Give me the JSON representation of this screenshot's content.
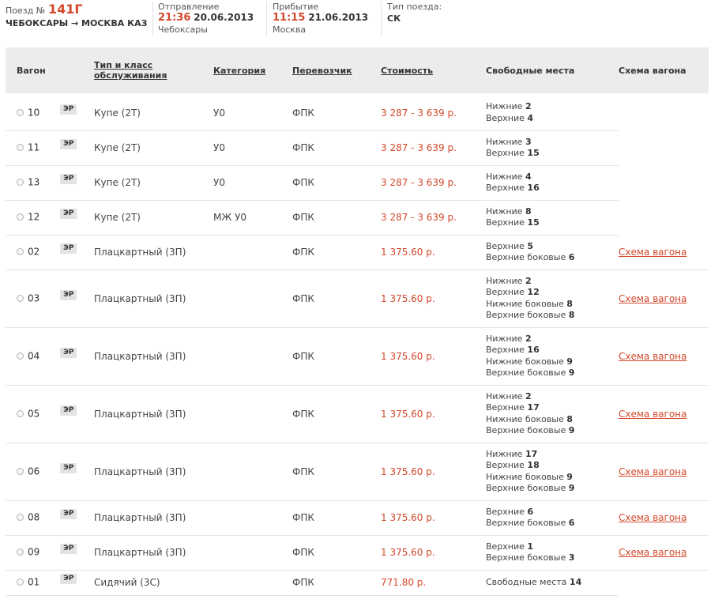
{
  "header": {
    "train_label": "Поезд №",
    "train_number": "141Г",
    "route": "ЧЕБОКСАРЫ → МОСКВА КАЗ",
    "departure_label": "Отправление",
    "departure_time": "21:36",
    "departure_date": "20.06.2013",
    "departure_city": "Чебоксары",
    "arrival_label": "Прибытие",
    "arrival_time": "11:15",
    "arrival_date": "21.06.2013",
    "arrival_city": "Москва",
    "train_type_label": "Тип поезда:",
    "train_type": "СК"
  },
  "columns": {
    "wagon": "Вагон",
    "class_line1": "Тип и класс",
    "class_line2": "обслуживания",
    "category": "Категория",
    "carrier": "Перевозчик",
    "cost": "Стоимость",
    "free_seats": "Свободные места",
    "schema": "Схема вагона"
  },
  "badge_label": "ЭР",
  "schema_link_label": "Схема вагона",
  "colors": {
    "accent": "#d3482b",
    "header_bg": "#ececec"
  },
  "rows": [
    {
      "car": "10",
      "cls": "Купе (2Т)",
      "cat": "У0",
      "carrier": "ФПК",
      "price": "3 287 - 3 639 р.",
      "schema": false,
      "seats": [
        {
          "label": "Нижние",
          "count": "2"
        },
        {
          "label": "Верхние",
          "count": "4"
        }
      ]
    },
    {
      "car": "11",
      "cls": "Купе (2Т)",
      "cat": "У0",
      "carrier": "ФПК",
      "price": "3 287 - 3 639 р.",
      "schema": false,
      "seats": [
        {
          "label": "Нижние",
          "count": "3"
        },
        {
          "label": "Верхние",
          "count": "15"
        }
      ]
    },
    {
      "car": "13",
      "cls": "Купе (2Т)",
      "cat": "У0",
      "carrier": "ФПК",
      "price": "3 287 - 3 639 р.",
      "schema": false,
      "seats": [
        {
          "label": "Нижние",
          "count": "4"
        },
        {
          "label": "Верхние",
          "count": "16"
        }
      ]
    },
    {
      "car": "12",
      "cls": "Купе (2Т)",
      "cat": "МЖ У0",
      "carrier": "ФПК",
      "price": "3 287 - 3 639 р.",
      "schema": false,
      "seats": [
        {
          "label": "Нижние",
          "count": "8"
        },
        {
          "label": "Верхние",
          "count": "15"
        }
      ]
    },
    {
      "car": "02",
      "cls": "Плацкартный (3П)",
      "cat": "",
      "carrier": "ФПК",
      "price": "1 375.60 р.",
      "schema": true,
      "seats": [
        {
          "label": "Верхние",
          "count": "5"
        },
        {
          "label": "Верхние боковые",
          "count": "6"
        }
      ]
    },
    {
      "car": "03",
      "cls": "Плацкартный (3П)",
      "cat": "",
      "carrier": "ФПК",
      "price": "1 375.60 р.",
      "schema": true,
      "seats": [
        {
          "label": "Нижние",
          "count": "2"
        },
        {
          "label": "Верхние",
          "count": "12"
        },
        {
          "label": "Нижние боковые",
          "count": "8"
        },
        {
          "label": "Верхние боковые",
          "count": "8"
        }
      ]
    },
    {
      "car": "04",
      "cls": "Плацкартный (3П)",
      "cat": "",
      "carrier": "ФПК",
      "price": "1 375.60 р.",
      "schema": true,
      "seats": [
        {
          "label": "Нижние",
          "count": "2"
        },
        {
          "label": "Верхние",
          "count": "16"
        },
        {
          "label": "Нижние боковые",
          "count": "9"
        },
        {
          "label": "Верхние боковые",
          "count": "9"
        }
      ]
    },
    {
      "car": "05",
      "cls": "Плацкартный (3П)",
      "cat": "",
      "carrier": "ФПК",
      "price": "1 375.60 р.",
      "schema": true,
      "seats": [
        {
          "label": "Нижние",
          "count": "2"
        },
        {
          "label": "Верхние",
          "count": "17"
        },
        {
          "label": "Нижние боковые",
          "count": "8"
        },
        {
          "label": "Верхние боковые",
          "count": "9"
        }
      ]
    },
    {
      "car": "06",
      "cls": "Плацкартный (3П)",
      "cat": "",
      "carrier": "ФПК",
      "price": "1 375.60 р.",
      "schema": true,
      "seats": [
        {
          "label": "Нижние",
          "count": "17"
        },
        {
          "label": "Верхние",
          "count": "18"
        },
        {
          "label": "Нижние боковые",
          "count": "9"
        },
        {
          "label": "Верхние боковые",
          "count": "9"
        }
      ]
    },
    {
      "car": "08",
      "cls": "Плацкартный (3П)",
      "cat": "",
      "carrier": "ФПК",
      "price": "1 375.60 р.",
      "schema": true,
      "seats": [
        {
          "label": "Верхние",
          "count": "6"
        },
        {
          "label": "Верхние боковые",
          "count": "6"
        }
      ]
    },
    {
      "car": "09",
      "cls": "Плацкартный (3П)",
      "cat": "",
      "carrier": "ФПК",
      "price": "1 375.60 р.",
      "schema": true,
      "seats": [
        {
          "label": "Верхние",
          "count": "1"
        },
        {
          "label": "Верхние боковые",
          "count": "3"
        }
      ]
    },
    {
      "car": "01",
      "cls": "Сидячий (3С)",
      "cat": "",
      "carrier": "ФПК",
      "price": "771.80 р.",
      "schema": false,
      "seats": [
        {
          "label": "Свободные места",
          "count": "14"
        }
      ]
    }
  ]
}
